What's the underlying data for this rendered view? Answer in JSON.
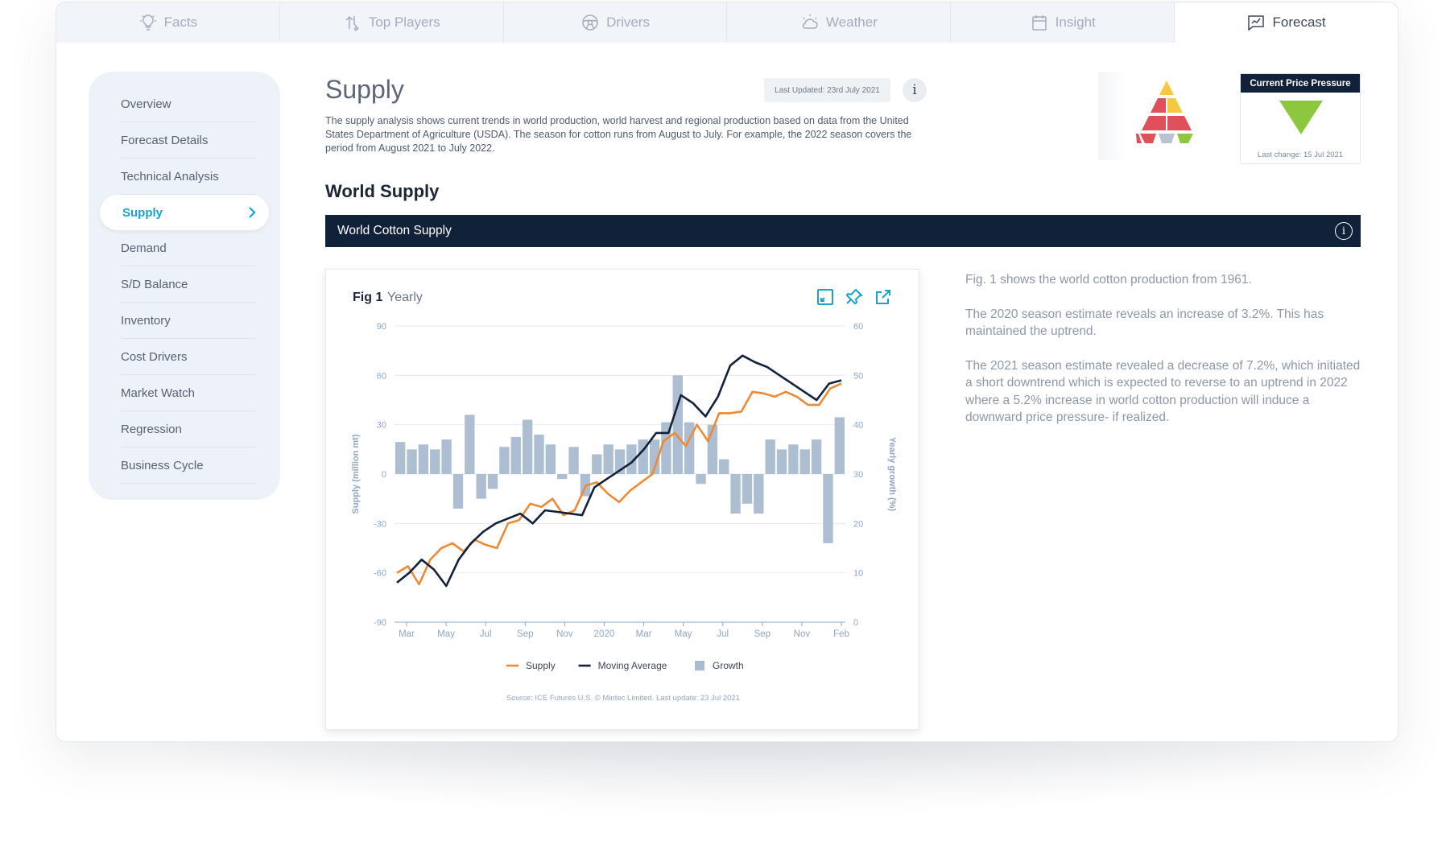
{
  "tabs": [
    {
      "label": "Facts",
      "icon": "lightbulb-icon",
      "active": false
    },
    {
      "label": "Top Players",
      "icon": "arrows-icon",
      "active": false
    },
    {
      "label": "Drivers",
      "icon": "steering-wheel-icon",
      "active": false
    },
    {
      "label": "Weather",
      "icon": "weather-icon",
      "active": false
    },
    {
      "label": "Insight",
      "icon": "calendar-icon",
      "active": false
    },
    {
      "label": "Forecast",
      "icon": "chart-message-icon",
      "active": true
    }
  ],
  "sidebar": {
    "items": [
      {
        "label": "Overview"
      },
      {
        "label": "Forecast Details"
      },
      {
        "label": "Technical Analysis"
      },
      {
        "label": "Supply",
        "active": true
      },
      {
        "label": "Demand"
      },
      {
        "label": "S/D Balance"
      },
      {
        "label": "Inventory"
      },
      {
        "label": "Cost Drivers"
      },
      {
        "label": "Market Watch"
      },
      {
        "label": "Regression"
      },
      {
        "label": "Business Cycle"
      }
    ]
  },
  "header": {
    "title": "Supply",
    "last_updated": "Last Updated: 23rd July 2021",
    "info": "i",
    "description": "The supply analysis shows current trends in world production, world harvest and regional production based on data from the United States Department of Agriculture (USDA). The season for cotton runs from August to July. For example, the 2022 season covers the period from August 2021 to July 2022."
  },
  "price_pressure": {
    "title": "Current Price Pressure",
    "last_change": "Last change: 15 Jul 2021",
    "direction": "down",
    "indicator_color": "#8dc63f"
  },
  "pyramid_colors": {
    "yellow": "#f5c842",
    "red": "#e0505a",
    "green": "#8dc63f",
    "grey": "#b8c3d1"
  },
  "section": {
    "title": "World Supply",
    "bar_title": "World Cotton Supply",
    "bar_info": "i"
  },
  "figure": {
    "label": "Fig 1",
    "sub": "Yearly",
    "icons": [
      "expand-icon",
      "pin-icon",
      "external-link-icon"
    ],
    "source": "Source: ICE Futures U.S. © Mintec Limited. Last update: 23 Jul 2021"
  },
  "chart_data": {
    "type": "line",
    "title": "",
    "xlabel": "",
    "ylabel": "Supply (million mt)",
    "y2label": "Yearly growth (%)",
    "ylim": [
      -90,
      90
    ],
    "y2lim": [
      0,
      60
    ],
    "y_ticks": [
      90,
      60,
      30,
      0,
      -30,
      -60,
      -90
    ],
    "y2_ticks": [
      60,
      50,
      40,
      30,
      20,
      10,
      0
    ],
    "x_tick_labels": [
      "Mar",
      "May",
      "Jul",
      "Sep",
      "Nov",
      "2020",
      "Mar",
      "May",
      "Jul",
      "Sep",
      "Nov",
      "Feb"
    ],
    "grid": true,
    "legend": "bottom",
    "series": [
      {
        "name": "Supply",
        "kind": "line",
        "color": "#ee8a33",
        "values": [
          -60,
          -56,
          -67,
          -52,
          -45,
          -42,
          -47,
          -40,
          -43,
          -45,
          -30,
          -28,
          -18,
          -20,
          -15,
          -25,
          -22,
          -7,
          -5,
          -12,
          -17,
          -10,
          -5,
          0,
          20,
          25,
          17,
          30,
          20,
          37,
          37,
          38,
          50,
          49,
          47,
          50,
          47,
          42,
          42,
          52,
          55
        ]
      },
      {
        "name": "Moving Average",
        "kind": "line",
        "color": "#12213a",
        "values": [
          -66,
          -60,
          -52,
          -58,
          -68,
          -52,
          -42,
          -35,
          -30,
          -27,
          -24,
          -30,
          -22,
          -23,
          -24,
          -25,
          -8,
          -3,
          2,
          7,
          15,
          25,
          25,
          48,
          43,
          35,
          47,
          66,
          72,
          68,
          65,
          60,
          55,
          50,
          45,
          55,
          57
        ]
      },
      {
        "name": "Growth",
        "kind": "bar",
        "color": "#a9bbd0",
        "values": [
          36.5,
          35,
          36,
          35,
          37,
          23,
          42,
          25,
          27,
          35.5,
          37.5,
          41,
          38,
          36,
          29,
          35.5,
          25.5,
          34,
          36,
          35,
          36,
          37,
          37,
          40.5,
          50,
          40.5,
          28,
          40,
          33,
          22,
          24,
          22,
          37,
          35,
          36,
          35,
          37,
          16,
          41.5
        ]
      }
    ]
  },
  "notes": [
    "Fig. 1 shows the world cotton production from 1961.",
    "The 2020 season estimate reveals an increase of 3.2%. This has maintained the uptrend.",
    "The 2021 season estimate revealed a decrease of 7.2%, which initiated a short downtrend which is expected to reverse to an uptrend in 2022 where a 5.2% increase in world cotton production will induce a downward price pressure- if realized."
  ]
}
